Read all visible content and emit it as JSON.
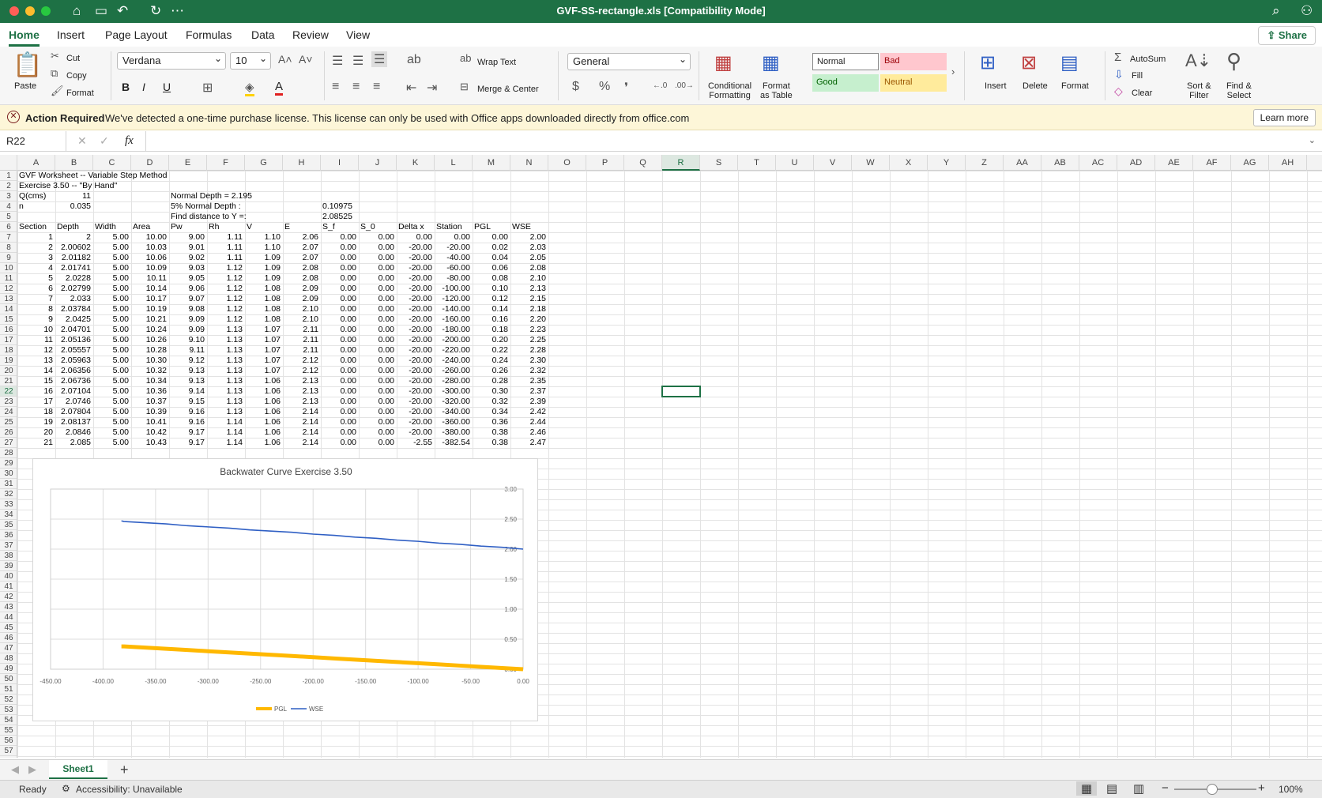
{
  "window": {
    "title": "GVF-SS-rectangle.xls  [Compatibility Mode]"
  },
  "tabs": [
    "Home",
    "Insert",
    "Page Layout",
    "Formulas",
    "Data",
    "Review",
    "View"
  ],
  "share_label": "Share",
  "ribbon": {
    "paste": "Paste",
    "cut": "Cut",
    "copy": "Copy",
    "format_painter": "Format",
    "font_name": "Verdana",
    "font_size": "10",
    "wrap_text": "Wrap Text",
    "merge_center": "Merge & Center",
    "number_format": "General",
    "conditional_formatting": "Conditional\nFormatting",
    "format_as_table": "Format\nas Table",
    "styles": {
      "normal": "Normal",
      "bad": "Bad",
      "good": "Good",
      "neutral": "Neutral"
    },
    "insert": "Insert",
    "delete": "Delete",
    "format": "Format",
    "autosum": "AutoSum",
    "fill": "Fill",
    "clear": "Clear",
    "sort_filter": "Sort &\nFilter",
    "find_select": "Find &\nSelect"
  },
  "message_bar": {
    "title": "Action Required",
    "text": "We've detected a one-time purchase license. This license can only be used with Office apps downloaded directly from office.com",
    "button": "Learn more"
  },
  "formula_bar": {
    "name_box": "R22",
    "fx": "fx",
    "value": ""
  },
  "columns": [
    "A",
    "B",
    "C",
    "D",
    "E",
    "F",
    "G",
    "H",
    "I",
    "J",
    "K",
    "L",
    "M",
    "N",
    "O",
    "P",
    "Q",
    "R",
    "S",
    "T",
    "U",
    "V",
    "W",
    "X",
    "Y",
    "Z",
    "AA",
    "AB",
    "AC",
    "AD",
    "AE",
    "AF",
    "AG",
    "AH"
  ],
  "selected_column": "R",
  "selected_row": 22,
  "rows_visible": 57,
  "header_cells": {
    "r1": "GVF Worksheet -- Variable Step Method",
    "r2": "Exercise 3.50 -- \"By Hand\"",
    "r3a": "Q(cms)",
    "r3b": "11",
    "r3e": "Normal Depth = 2.195",
    "r4a": "n",
    "r4b": "0.035",
    "r4e": "5% Normal Depth :",
    "r4i": "0.10975",
    "r5e": "Find distance to Y =:",
    "r5i": "2.08525"
  },
  "table_headers": [
    "Section",
    "Depth",
    "Width",
    "Area",
    "Pw",
    "Rh",
    "V",
    "E",
    "S_f",
    "S_0",
    "Delta x",
    "Station",
    "PGL",
    "WSE"
  ],
  "table_rows": [
    [
      "1",
      "2",
      "5.00",
      "10.00",
      "9.00",
      "1.11",
      "1.10",
      "2.06",
      "0.00",
      "0.00",
      "0.00",
      "0.00",
      "0.00",
      "2.00"
    ],
    [
      "2",
      "2.00602",
      "5.00",
      "10.03",
      "9.01",
      "1.11",
      "1.10",
      "2.07",
      "0.00",
      "0.00",
      "-20.00",
      "-20.00",
      "0.02",
      "2.03"
    ],
    [
      "3",
      "2.01182",
      "5.00",
      "10.06",
      "9.02",
      "1.11",
      "1.09",
      "2.07",
      "0.00",
      "0.00",
      "-20.00",
      "-40.00",
      "0.04",
      "2.05"
    ],
    [
      "4",
      "2.01741",
      "5.00",
      "10.09",
      "9.03",
      "1.12",
      "1.09",
      "2.08",
      "0.00",
      "0.00",
      "-20.00",
      "-60.00",
      "0.06",
      "2.08"
    ],
    [
      "5",
      "2.0228",
      "5.00",
      "10.11",
      "9.05",
      "1.12",
      "1.09",
      "2.08",
      "0.00",
      "0.00",
      "-20.00",
      "-80.00",
      "0.08",
      "2.10"
    ],
    [
      "6",
      "2.02799",
      "5.00",
      "10.14",
      "9.06",
      "1.12",
      "1.08",
      "2.09",
      "0.00",
      "0.00",
      "-20.00",
      "-100.00",
      "0.10",
      "2.13"
    ],
    [
      "7",
      "2.033",
      "5.00",
      "10.17",
      "9.07",
      "1.12",
      "1.08",
      "2.09",
      "0.00",
      "0.00",
      "-20.00",
      "-120.00",
      "0.12",
      "2.15"
    ],
    [
      "8",
      "2.03784",
      "5.00",
      "10.19",
      "9.08",
      "1.12",
      "1.08",
      "2.10",
      "0.00",
      "0.00",
      "-20.00",
      "-140.00",
      "0.14",
      "2.18"
    ],
    [
      "9",
      "2.0425",
      "5.00",
      "10.21",
      "9.09",
      "1.12",
      "1.08",
      "2.10",
      "0.00",
      "0.00",
      "-20.00",
      "-160.00",
      "0.16",
      "2.20"
    ],
    [
      "10",
      "2.04701",
      "5.00",
      "10.24",
      "9.09",
      "1.13",
      "1.07",
      "2.11",
      "0.00",
      "0.00",
      "-20.00",
      "-180.00",
      "0.18",
      "2.23"
    ],
    [
      "11",
      "2.05136",
      "5.00",
      "10.26",
      "9.10",
      "1.13",
      "1.07",
      "2.11",
      "0.00",
      "0.00",
      "-20.00",
      "-200.00",
      "0.20",
      "2.25"
    ],
    [
      "12",
      "2.05557",
      "5.00",
      "10.28",
      "9.11",
      "1.13",
      "1.07",
      "2.11",
      "0.00",
      "0.00",
      "-20.00",
      "-220.00",
      "0.22",
      "2.28"
    ],
    [
      "13",
      "2.05963",
      "5.00",
      "10.30",
      "9.12",
      "1.13",
      "1.07",
      "2.12",
      "0.00",
      "0.00",
      "-20.00",
      "-240.00",
      "0.24",
      "2.30"
    ],
    [
      "14",
      "2.06356",
      "5.00",
      "10.32",
      "9.13",
      "1.13",
      "1.07",
      "2.12",
      "0.00",
      "0.00",
      "-20.00",
      "-260.00",
      "0.26",
      "2.32"
    ],
    [
      "15",
      "2.06736",
      "5.00",
      "10.34",
      "9.13",
      "1.13",
      "1.06",
      "2.13",
      "0.00",
      "0.00",
      "-20.00",
      "-280.00",
      "0.28",
      "2.35"
    ],
    [
      "16",
      "2.07104",
      "5.00",
      "10.36",
      "9.14",
      "1.13",
      "1.06",
      "2.13",
      "0.00",
      "0.00",
      "-20.00",
      "-300.00",
      "0.30",
      "2.37"
    ],
    [
      "17",
      "2.0746",
      "5.00",
      "10.37",
      "9.15",
      "1.13",
      "1.06",
      "2.13",
      "0.00",
      "0.00",
      "-20.00",
      "-320.00",
      "0.32",
      "2.39"
    ],
    [
      "18",
      "2.07804",
      "5.00",
      "10.39",
      "9.16",
      "1.13",
      "1.06",
      "2.14",
      "0.00",
      "0.00",
      "-20.00",
      "-340.00",
      "0.34",
      "2.42"
    ],
    [
      "19",
      "2.08137",
      "5.00",
      "10.41",
      "9.16",
      "1.14",
      "1.06",
      "2.14",
      "0.00",
      "0.00",
      "-20.00",
      "-360.00",
      "0.36",
      "2.44"
    ],
    [
      "20",
      "2.0846",
      "5.00",
      "10.42",
      "9.17",
      "1.14",
      "1.06",
      "2.14",
      "0.00",
      "0.00",
      "-20.00",
      "-380.00",
      "0.38",
      "2.46"
    ],
    [
      "21",
      "2.085",
      "5.00",
      "10.43",
      "9.17",
      "1.14",
      "1.06",
      "2.14",
      "0.00",
      "0.00",
      "-2.55",
      "-382.54",
      "0.38",
      "2.47"
    ]
  ],
  "chart_data": {
    "type": "line",
    "title": "Backwater Curve Exercise 3.50",
    "xlim": [
      -450,
      0
    ],
    "ylim": [
      0,
      3
    ],
    "xticks": [
      "-450.00",
      "-400.00",
      "-350.00",
      "-300.00",
      "-250.00",
      "-200.00",
      "-150.00",
      "-100.00",
      "-50.00",
      "0.00"
    ],
    "yticks": [
      "0.00",
      "0.50",
      "1.00",
      "1.50",
      "2.00",
      "2.50",
      "3.00"
    ],
    "grid": true,
    "legend": "bottom",
    "x": [
      0,
      -20,
      -40,
      -60,
      -80,
      -100,
      -120,
      -140,
      -160,
      -180,
      -200,
      -220,
      -240,
      -260,
      -280,
      -300,
      -320,
      -340,
      -360,
      -380,
      -382.54
    ],
    "series": [
      {
        "name": "PGL",
        "color": "#ffb800",
        "values": [
          0.0,
          0.02,
          0.04,
          0.06,
          0.08,
          0.1,
          0.12,
          0.14,
          0.16,
          0.18,
          0.2,
          0.22,
          0.24,
          0.26,
          0.28,
          0.3,
          0.32,
          0.34,
          0.36,
          0.38,
          0.38
        ]
      },
      {
        "name": "WSE",
        "color": "#2f5fc4",
        "values": [
          2.0,
          2.03,
          2.05,
          2.08,
          2.1,
          2.13,
          2.15,
          2.18,
          2.2,
          2.23,
          2.25,
          2.28,
          2.3,
          2.32,
          2.35,
          2.37,
          2.39,
          2.42,
          2.44,
          2.46,
          2.47
        ]
      }
    ]
  },
  "sheet_tab": "Sheet1",
  "status": {
    "ready": "Ready",
    "accessibility": "Accessibility: Unavailable",
    "zoom": "100%"
  },
  "colors": {
    "accent": "#1e7145"
  }
}
